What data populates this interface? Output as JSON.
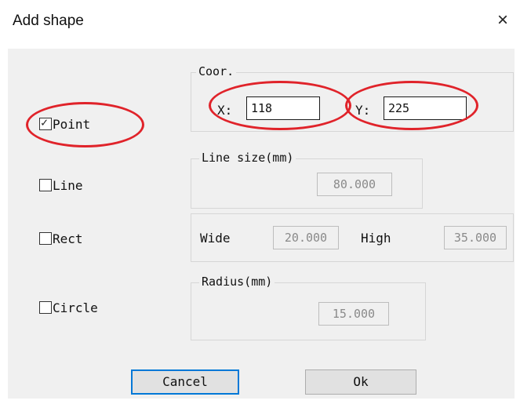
{
  "dialog": {
    "title": "Add shape",
    "close_glyph": "×"
  },
  "shapes": {
    "point": {
      "label": "Point",
      "checked": true
    },
    "line": {
      "label": "Line",
      "checked": false
    },
    "rect": {
      "label": "Rect",
      "checked": false
    },
    "circle": {
      "label": "Circle",
      "checked": false
    }
  },
  "coor": {
    "legend": "Coor.",
    "x_label": "X:",
    "x_value": "118",
    "y_label": "Y:",
    "y_value": "225"
  },
  "line_size": {
    "legend": "Line size(mm)",
    "value": "80.000"
  },
  "rect": {
    "wide_label": "Wide",
    "wide_value": "20.000",
    "high_label": "High",
    "high_value": "35.000"
  },
  "radius": {
    "legend": "Radius(mm)",
    "value": "15.000"
  },
  "buttons": {
    "cancel": "Cancel",
    "ok": "Ok"
  },
  "annotation": {
    "color": "#e0232a"
  },
  "icons": {
    "check": "check-icon",
    "close": "close-icon"
  }
}
